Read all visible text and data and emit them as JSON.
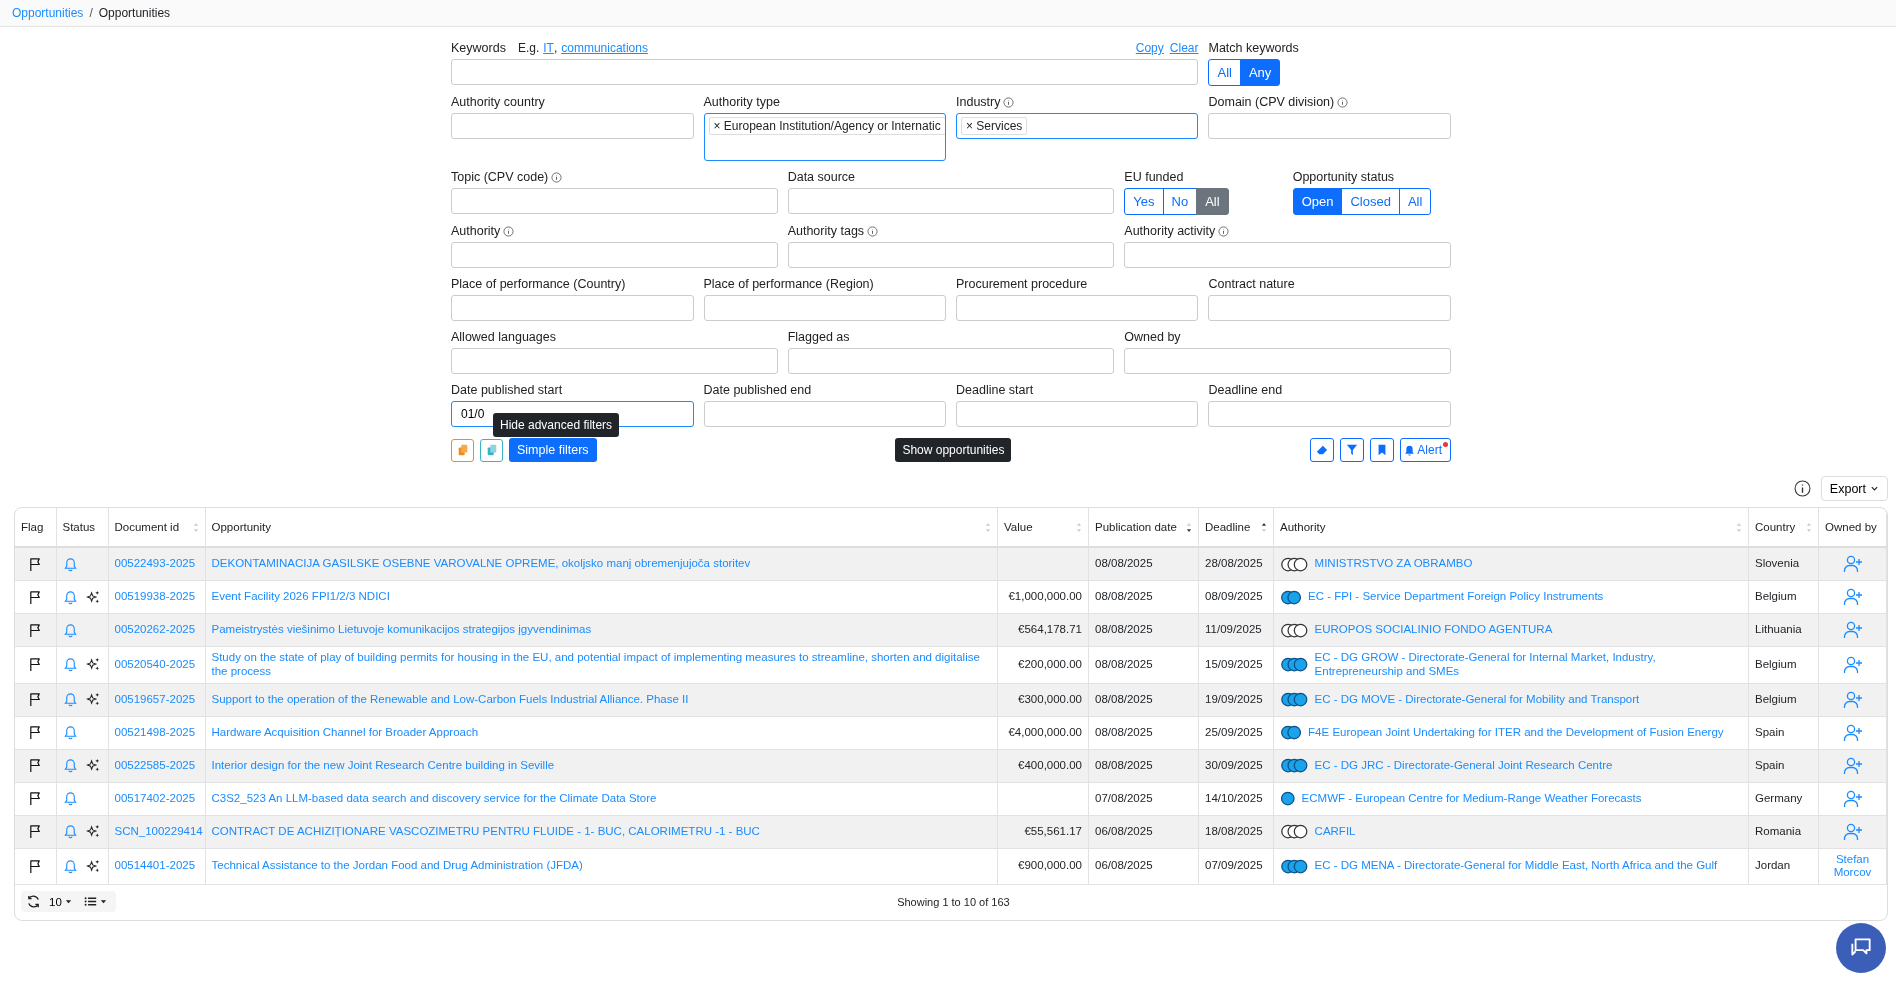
{
  "breadcrumb": [
    {
      "label": "Opportunities",
      "link": true
    },
    {
      "label": "Opportunities",
      "link": false
    }
  ],
  "breadcrumb_separator": "/",
  "keywords": {
    "label": "Keywords",
    "hint": "E.g.",
    "examples": [
      "IT",
      "communications"
    ],
    "examples_separator": ",",
    "actions": [
      "Copy",
      "Clear"
    ]
  },
  "match_keywords": {
    "label": "Match keywords",
    "options": [
      {
        "label": "All",
        "selected": false
      },
      {
        "label": "Any",
        "selected": true
      }
    ]
  },
  "filter_rows": [
    {
      "fields": [
        {
          "kind": "input",
          "label": "Authority country",
          "info": false
        },
        {
          "kind": "tags",
          "label": "Authority type",
          "info": false,
          "tags": [
            {
              "remove": "×",
              "label": "European Institution/Agency or Internatic"
            }
          ]
        },
        {
          "kind": "tags",
          "label": "Industry",
          "info": true,
          "tags": [
            {
              "remove": "×",
              "label": "Services"
            }
          ]
        },
        {
          "kind": "input",
          "label": "Domain (CPV division)",
          "info": true
        }
      ]
    },
    {
      "fields": [
        {
          "kind": "input",
          "label": "Topic (CPV code)",
          "info": true
        },
        {
          "kind": "input",
          "label": "Data source",
          "info": false
        },
        {
          "kind": "choice",
          "label": "EU funded",
          "info": false,
          "options": [
            {
              "label": "Yes",
              "selected": false
            },
            {
              "label": "No",
              "selected": false
            },
            {
              "label": "All",
              "selected": true
            }
          ]
        },
        {
          "kind": "toggle",
          "label": "Opportunity status",
          "info": false,
          "options": [
            {
              "label": "Open",
              "selected": true
            },
            {
              "label": "Closed",
              "selected": false
            },
            {
              "label": "All",
              "selected": false
            }
          ]
        }
      ]
    },
    {
      "fields": [
        {
          "kind": "input",
          "label": "Authority",
          "info": true
        },
        {
          "kind": "input",
          "label": "Authority tags",
          "info": true
        },
        {
          "kind": "input",
          "label": "Authority activity",
          "info": true
        }
      ]
    },
    {
      "fields": [
        {
          "kind": "input",
          "label": "Place of performance (Country)",
          "info": false
        },
        {
          "kind": "input",
          "label": "Place of performance (Region)",
          "info": false
        },
        {
          "kind": "input",
          "label": "Procurement procedure",
          "info": false
        },
        {
          "kind": "input",
          "label": "Contract nature",
          "info": false
        }
      ]
    },
    {
      "fields": [
        {
          "kind": "input",
          "label": "Allowed languages",
          "info": false
        },
        {
          "kind": "input",
          "label": "Flagged as",
          "info": false
        },
        {
          "kind": "input",
          "label": "Owned by",
          "info": false
        }
      ]
    },
    {
      "fields": [
        {
          "kind": "input",
          "label": "Date published start",
          "info": false,
          "value": "01/0",
          "focused": true
        },
        {
          "kind": "input",
          "label": "Date published end",
          "info": false
        },
        {
          "kind": "input",
          "label": "Deadline start",
          "info": false
        },
        {
          "kind": "input",
          "label": "Deadline end",
          "info": false
        }
      ]
    }
  ],
  "actions": {
    "simple_filters": "Simple filters",
    "tooltip_left": "Hide advanced filters",
    "tooltip_center": "Show opportunities",
    "alert": "Alert",
    "alert_dot": true
  },
  "export": "Export",
  "table": {
    "columns": [
      {
        "label": "Flag",
        "sortable": false
      },
      {
        "label": "Status",
        "sortable": false
      },
      {
        "label": "Document id",
        "sortable": true,
        "sort_asc": false,
        "sort_desc": false
      },
      {
        "label": "Opportunity",
        "sortable": true,
        "sort_asc": false,
        "sort_desc": false
      },
      {
        "label": "Value",
        "sortable": true,
        "sort_asc": false,
        "sort_desc": false
      },
      {
        "label": "Publication date",
        "sortable": true,
        "sort_asc": false,
        "sort_desc": true
      },
      {
        "label": "Deadline",
        "sortable": true,
        "sort_asc": true,
        "sort_desc": false
      },
      {
        "label": "Authority",
        "sortable": true,
        "sort_asc": false,
        "sort_desc": false
      },
      {
        "label": "Country",
        "sortable": true,
        "sort_asc": false,
        "sort_desc": false
      },
      {
        "label": "Owned by",
        "sortable": false
      }
    ],
    "rows": [
      {
        "doc_id": "00522493-2025",
        "opportunity": "DEKONTAMINACIJA GASILSKE OSEBNE VAROVALNE OPREME, okoljsko manj obremenjujoča storitev",
        "ai": false,
        "published": "08/08/2025",
        "deadline": "28/08/2025",
        "authority": "MINISTRSTVO ZA OBRAMBO",
        "kind": "outline3",
        "country": "Slovenia"
      },
      {
        "doc_id": "00519938-2025",
        "opportunity": "Event Facility 2026 FPI1/2/3 NDICI",
        "ai": true,
        "value": "€1,000,000.00",
        "published": "08/08/2025",
        "deadline": "08/09/2025",
        "authority": "EC - FPI - Service Department Foreign Policy Instruments",
        "kind": "filled2",
        "country": "Belgium"
      },
      {
        "doc_id": "00520262-2025",
        "opportunity": "Pameistrystės viešinimo Lietuvoje komunikacijos strategijos įgyvendinimas",
        "ai": false,
        "value": "€564,178.71",
        "published": "08/08/2025",
        "deadline": "11/09/2025",
        "authority": "EUROPOS SOCIALINIO FONDO AGENTURA",
        "kind": "outline3",
        "country": "Lithuania"
      },
      {
        "doc_id": "00520540-2025",
        "opportunity": "Study on the state of play of building permits for housing in the EU, and potential impact of implementing measures to streamline, shorten and digitalise the process",
        "ai": true,
        "value": "€200,000.00",
        "published": "08/08/2025",
        "deadline": "15/09/2025",
        "authority": "EC - DG GROW - Directorate-General for Internal Market, Industry, Entrepreneurship and SMEs",
        "kind": "filled3",
        "country": "Belgium"
      },
      {
        "doc_id": "00519657-2025",
        "opportunity": "Support to the operation of the Renewable and Low-Carbon Fuels Industrial Alliance. Phase II",
        "ai": true,
        "value": "€300,000.00",
        "published": "08/08/2025",
        "deadline": "19/09/2025",
        "authority": "EC - DG MOVE - Directorate-General for Mobility and Transport",
        "kind": "filled3",
        "country": "Belgium"
      },
      {
        "doc_id": "00521498-2025",
        "opportunity": "Hardware Acquisition Channel for Broader Approach",
        "ai": false,
        "value": "€4,000,000.00",
        "published": "08/08/2025",
        "deadline": "25/09/2025",
        "authority": "F4E European Joint Undertaking for ITER and the Development of Fusion Energy",
        "kind": "filled2",
        "country": "Spain"
      },
      {
        "doc_id": "00522585-2025",
        "opportunity": "Interior design for the new Joint Research Centre building in Seville",
        "ai": true,
        "value": "€400,000.00",
        "published": "08/08/2025",
        "deadline": "30/09/2025",
        "authority": "EC - DG JRC - Directorate-General Joint Research Centre",
        "kind": "filled3",
        "country": "Spain"
      },
      {
        "doc_id": "00517402-2025",
        "opportunity": "C3S2_523 An LLM-based data search and discovery service for the Climate Data Store",
        "ai": false,
        "published": "07/08/2025",
        "deadline": "14/10/2025",
        "authority": "ECMWF - European Centre for Medium-Range Weather Forecasts",
        "kind": "filled1",
        "country": "Germany"
      },
      {
        "doc_id": "SCN_100229414",
        "opportunity": "CONTRACT DE ACHIZIȚIONARE VASCOZIMETRU PENTRU FLUIDE - 1- BUC, CALORIMETRU -1 - BUC",
        "ai": true,
        "value": "€55,561.17",
        "published": "06/08/2025",
        "deadline": "18/08/2025",
        "authority": "CARFIL",
        "kind": "outline3",
        "country": "Romania"
      },
      {
        "doc_id": "00514401-2025",
        "opportunity": "Technical Assistance to the Jordan Food and Drug Administration (JFDA)",
        "ai": true,
        "value": "€900,000.00",
        "published": "06/08/2025",
        "deadline": "07/09/2025",
        "authority": "EC - DG MENA - Directorate-General for Middle East, North Africa and the Gulf",
        "kind": "filled3",
        "country": "Jordan",
        "owner": "Stefan Morcov"
      }
    ]
  },
  "footer": {
    "page_size": "10",
    "summary": "Showing 1 to 10 of 163"
  }
}
